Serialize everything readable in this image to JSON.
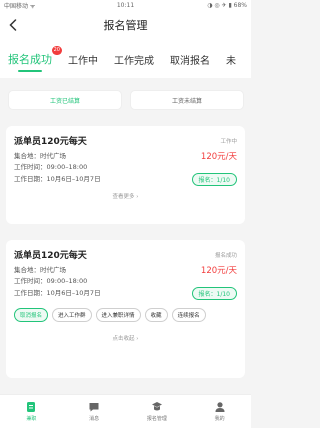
{
  "status_bar": {
    "carrier": "中国移动 ᯤ",
    "time": "10:11",
    "battery": "◑ ◎ ✈ ▮ 68%"
  },
  "header": {
    "title": "报名管理"
  },
  "tabs": [
    {
      "label": "报名成功",
      "badge": "20",
      "active": true
    },
    {
      "label": "工作中"
    },
    {
      "label": "工作完成"
    },
    {
      "label": "取消报名"
    },
    {
      "label": "未"
    }
  ],
  "filters": {
    "settled": "工资已结算",
    "unsettled": "工资未结算"
  },
  "cards": [
    {
      "title": "派单员120元每天",
      "status": "工作中",
      "location": "集合地：时代广场",
      "price": "120元/天",
      "work_time": "工作时间：09:00–18:00",
      "work_date": "工作日期：10月6日–10月7日",
      "report": "报名：1/10",
      "more": "查看更多 ›"
    },
    {
      "title": "派单员120元每天",
      "status": "报名成功",
      "location": "集合地：时代广场",
      "price": "120元/天",
      "work_time": "工作时间：09:00–18:00",
      "work_date": "工作日期：10月6日–10月7日",
      "report": "报名：1/10",
      "actions": [
        "取消报名",
        "进入工作群",
        "进入兼职详情",
        "收藏",
        "连续报名"
      ],
      "more": "点击收起 ›"
    }
  ],
  "tabbar": [
    {
      "label": "兼职",
      "icon": "job-icon",
      "active": true
    },
    {
      "label": "消息",
      "icon": "message-icon"
    },
    {
      "label": "报名管理",
      "icon": "signup-management-icon"
    },
    {
      "label": "我的",
      "icon": "profile-icon"
    }
  ],
  "colors": {
    "accent": "#22c47a",
    "price": "#f23d3d",
    "background": "#f4f4f4"
  }
}
